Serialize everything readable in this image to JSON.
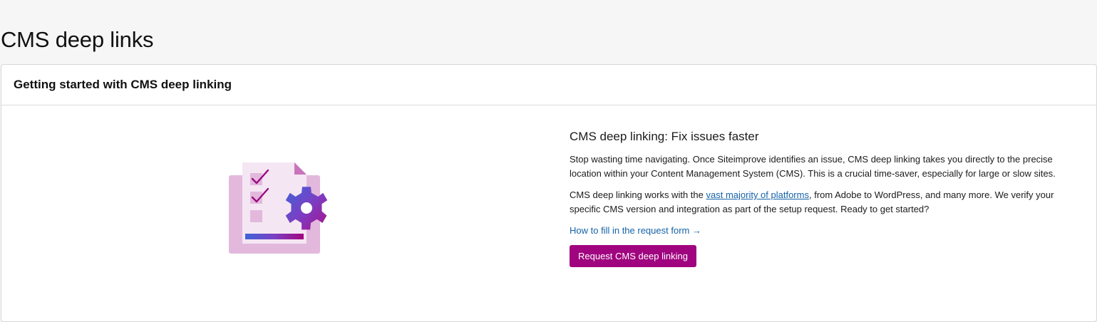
{
  "page": {
    "title": "CMS deep links"
  },
  "card": {
    "title": "Getting started with CMS deep linking",
    "illustration_icon": "checklist-gear-illustration",
    "section_title": "CMS deep linking: Fix issues faster",
    "paragraph1": "Stop wasting time navigating. Once Siteimprove identifies an issue, CMS deep linking takes you directly to the precise location within your Content Management System (CMS). This is a crucial time-saver, especially for large or slow sites.",
    "paragraph2_before": "CMS deep linking works with the ",
    "paragraph2_link": "vast majority of platforms",
    "paragraph2_after": ", from Adobe to WordPress, and many more. We verify your specific CMS version and integration as part of the setup request. Ready to get started?",
    "form_link": "How to fill in the request form →",
    "request_button": "Request CMS deep linking"
  },
  "colors": {
    "background": "#f6f6f6",
    "accent": "#a0047f",
    "link": "#1463a8"
  }
}
